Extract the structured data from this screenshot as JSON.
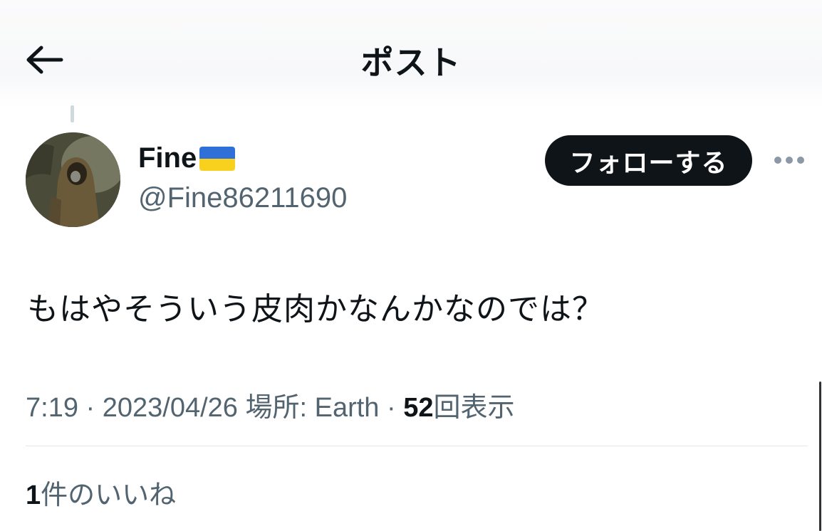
{
  "header": {
    "title": "ポスト",
    "back_icon": "arrow-left-icon"
  },
  "author": {
    "display_name": "Fine",
    "flag_icon": "ukraine-flag-icon",
    "handle": "@Fine86211690",
    "avatar_icon": "avatar-image"
  },
  "actions": {
    "follow_label": "フォローする",
    "more_icon": "more-dots-icon"
  },
  "post": {
    "text": "もはやそういう皮肉かなんかなのでは？"
  },
  "meta": {
    "time": "7:19",
    "separator": " · ",
    "date": "2023/04/26",
    "location_label": "場所: Earth",
    "views_count": "52",
    "views_label": "回表示"
  },
  "likes": {
    "count": "1",
    "label": "件のいいね"
  },
  "colors": {
    "text_primary": "#0f1419",
    "text_secondary": "#536471",
    "follow_bg": "#0f1419",
    "flag_blue": "#2f6fd8",
    "flag_yellow": "#f7d11e"
  }
}
